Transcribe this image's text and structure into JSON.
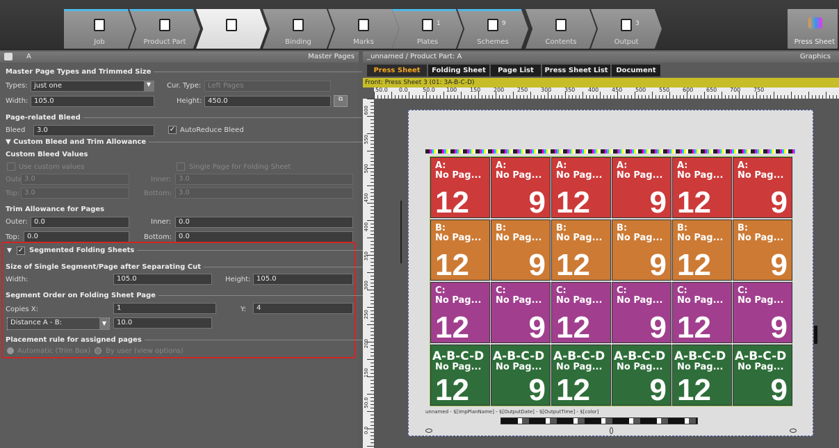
{
  "workflow_tabs": [
    {
      "label": "Job",
      "count": ""
    },
    {
      "label": "Product Part",
      "count": ""
    },
    {
      "label": "Master Pages",
      "count": ""
    },
    {
      "label": "Binding",
      "count": ""
    },
    {
      "label": "Marks",
      "count": ""
    },
    {
      "label": "Plates",
      "count": "1"
    },
    {
      "label": "Schemes",
      "count": "9"
    },
    {
      "label": "Contents",
      "count": ""
    },
    {
      "label": "Output",
      "count": "3"
    }
  ],
  "press_sheet_tab": "Press Sheet",
  "left_panel": {
    "header_left": "A",
    "header_right": "Master Pages",
    "sec_master": "Master Page Types and Trimmed Size",
    "types_label": "Types:",
    "types_value": "just one",
    "cur_type_label": "Cur. Type:",
    "cur_type_value": "Left Pages",
    "width_label": "Width:",
    "width_value": "105.0",
    "height_label": "Height:",
    "height_value": "450.0",
    "sec_bleed": "Page-related Bleed",
    "bleed_label": "Bleed",
    "bleed_value": "3.0",
    "auto_reduce": "AutoReduce Bleed",
    "sec_custom": "▼ Custom Bleed and Trim Allowance",
    "sub_custom": "Custom Bleed Values",
    "use_custom": "Use custom values",
    "single_page": "Single Page for Folding Sheet",
    "outer_label": "Outer:",
    "outer_value": "3.0",
    "inner_label": "Inner:",
    "inner_value": "3.0",
    "top_label": "Top:",
    "top_value": "3.0",
    "bottom_label": "Bottom:",
    "bottom_value": "3.0",
    "sub_trim": "Trim Allowance for Pages",
    "t_outer_label": "Outer:",
    "t_outer_value": "0.0",
    "t_inner_label": "Inner:",
    "t_inner_value": "0.0",
    "t_top_label": "Top:",
    "t_top_value": "0.0",
    "t_bottom_label": "Bottom:",
    "t_bottom_value": "0.0",
    "seg_title": "Segmented Folding Sheets",
    "sec_size": "Size of Single Segment/Page after Separating Cut",
    "s_width_label": "Width:",
    "s_width_value": "105.0",
    "s_height_label": "Height:",
    "s_height_value": "105.0",
    "sec_order": "Segment Order on Folding Sheet Page",
    "copies_label": "Copies X:",
    "copies_value": "1",
    "y_label": "Y:",
    "y_value": "4",
    "distance_label": "Distance A - B:",
    "distance_value": "10.0",
    "sec_placement": "Placement rule for assigned pages",
    "automatic": "Automatic (Trim Box)",
    "by_user": "By user (view options)"
  },
  "right_panel": {
    "header_left": "_unnamed / Product Part: A",
    "header_right": "Graphics",
    "view_tabs": [
      "Press Sheet",
      "Folding Sheet",
      "Page List",
      "Press Sheet List",
      "Document"
    ],
    "front_label": "Front: Press Sheet 3 (01: 3A-B-C-D)",
    "ruler_labels": [
      "50.0",
      "0.0",
      "50.0",
      "100",
      "150",
      "200",
      "250",
      "300",
      "350",
      "400",
      "450",
      "500",
      "550",
      "600",
      "650",
      "700",
      "750"
    ],
    "vruler_labels": [
      "600",
      "550",
      "500",
      "450",
      "400",
      "350",
      "300",
      "250",
      "200",
      "150",
      "50.0",
      "0.0"
    ],
    "footer_text": "unnamed  -  $[ImpPlanName]  -  $[OutputDate]  -  $[OutputTime]  -  $[color]"
  },
  "grid": {
    "row_labels": [
      "A:",
      "B:",
      "C:",
      "A-B-C-D"
    ],
    "row_colors": [
      "#cc3a3a",
      "#cc7a34",
      "#a13f8e",
      "#2f6e3a"
    ],
    "page_text": "No Pag...",
    "numbers": [
      "12",
      "9",
      "12",
      "9",
      "12",
      "9"
    ]
  },
  "colors": {
    "accent": "#f5a623",
    "highlight_box": "#d42424",
    "tab_highlight": "#4fb8e6"
  }
}
